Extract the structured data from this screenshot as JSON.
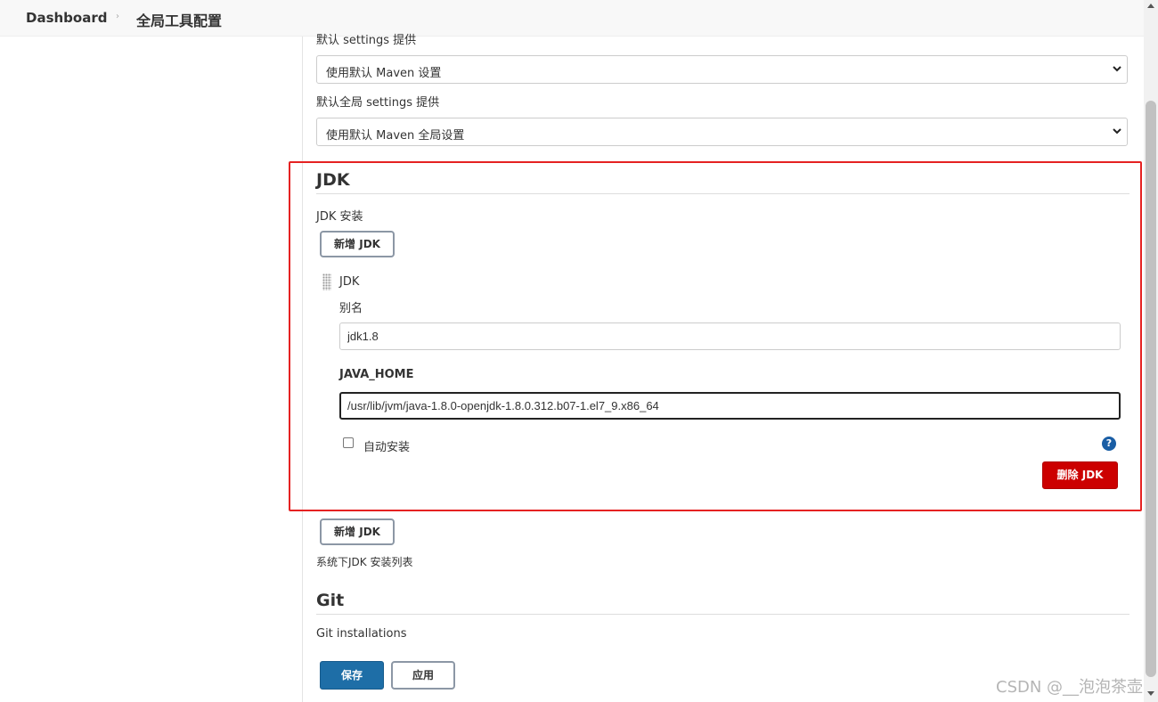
{
  "breadcrumb": {
    "dashboard": "Dashboard",
    "separator": "›",
    "current": "全局工具配置"
  },
  "maven": {
    "settings_label": "默认 settings 提供",
    "settings_value": "使用默认 Maven 设置",
    "global_settings_label": "默认全局 settings 提供",
    "global_settings_value": "使用默认 Maven 全局设置"
  },
  "jdk": {
    "section_title": "JDK",
    "installations_label": "JDK 安装",
    "add_button": "新增 JDK",
    "item_title": "JDK",
    "alias_label": "别名",
    "alias_value": "jdk1.8",
    "java_home_label": "JAVA_HOME",
    "java_home_value": "/usr/lib/jvm/java-1.8.0-openjdk-1.8.0.312.b07-1.el7_9.x86_64",
    "auto_install_label": "自动安装",
    "auto_install_checked": false,
    "help_icon": "?",
    "delete_button": "删除 JDK",
    "add_button_bottom": "新增 JDK",
    "list_hint": "系统下JDK 安装列表"
  },
  "git": {
    "section_title": "Git",
    "installations_label": "Git installations"
  },
  "actions": {
    "save": "保存",
    "apply": "应用"
  },
  "watermark": "CSDN @__泡泡茶壶",
  "colors": {
    "primary": "#1e6ea7",
    "danger": "#cc0000",
    "highlight_box": "#e52222"
  }
}
